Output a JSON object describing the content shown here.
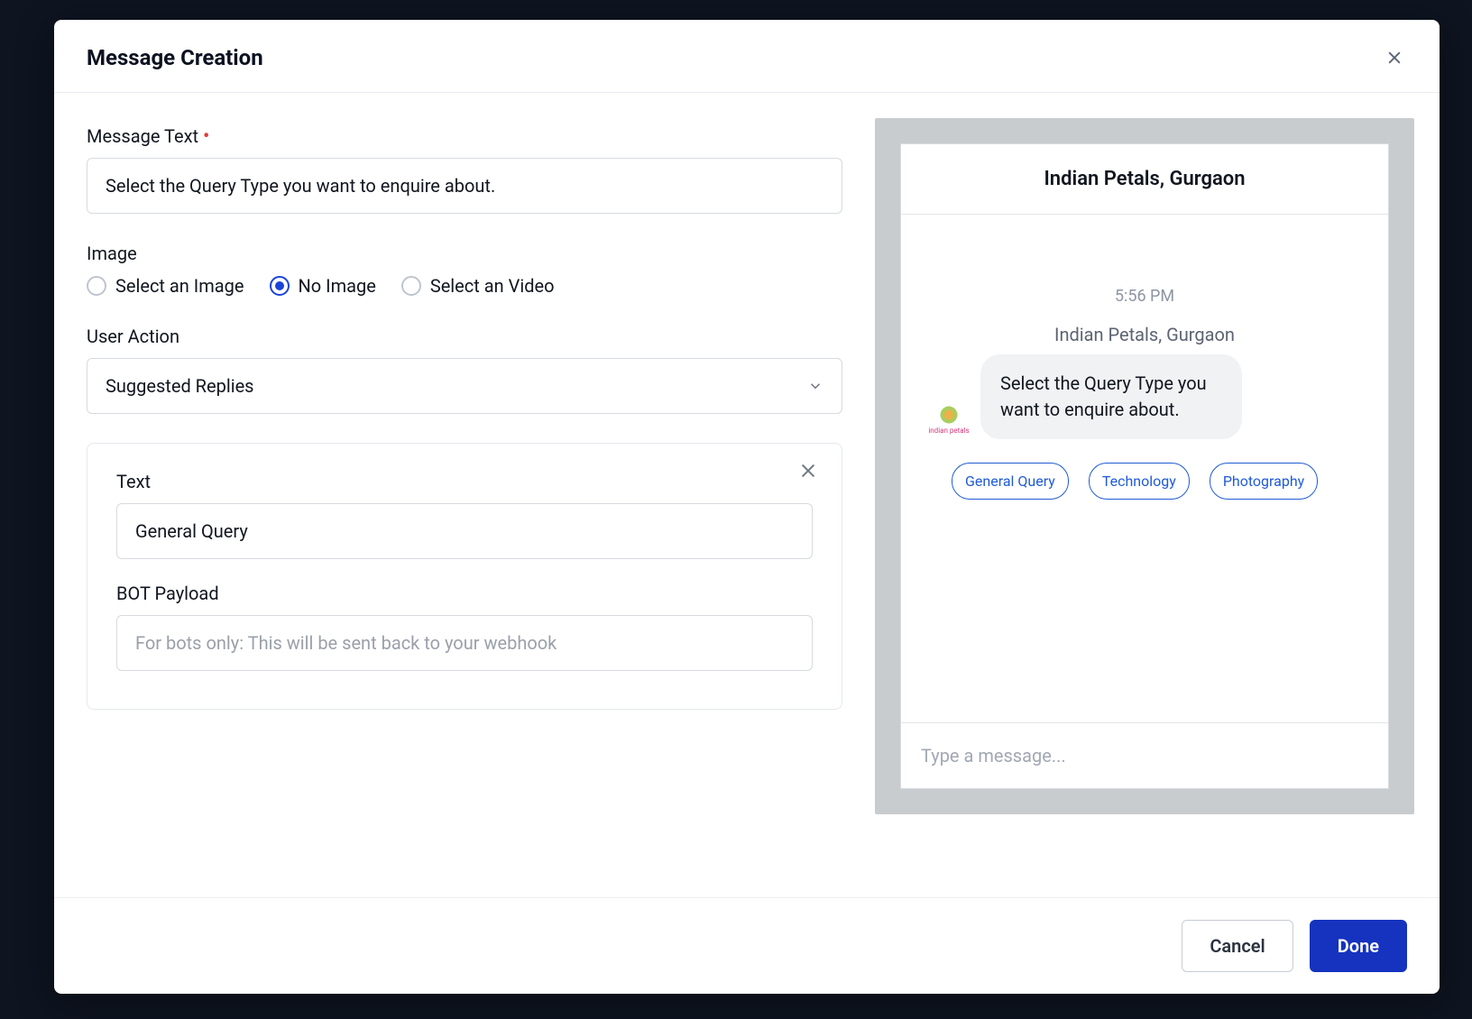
{
  "modal": {
    "title": "Message Creation",
    "footer": {
      "cancel": "Cancel",
      "done": "Done"
    }
  },
  "form": {
    "message_text": {
      "label": "Message Text",
      "value": "Select the Query Type you want to enquire about."
    },
    "image": {
      "label": "Image",
      "options": [
        "Select an Image",
        "No Image",
        "Select an Video"
      ],
      "selected_index": 1
    },
    "user_action": {
      "label": "User Action",
      "selected": "Suggested Replies"
    },
    "reply_card": {
      "text": {
        "label": "Text",
        "value": "General Query"
      },
      "payload": {
        "label": "BOT Payload",
        "placeholder": "For bots only: This will be sent back to your webhook"
      }
    }
  },
  "preview": {
    "header": "Indian Petals, Gurgaon",
    "time": "5:56 PM",
    "sender": "Indian Petals, Gurgaon",
    "avatar_label": "indian petals",
    "bubble": "Select the Query Type you want to enquire about.",
    "chips": [
      "General Query",
      "Technology",
      "Photography"
    ],
    "input_placeholder": "Type a message..."
  }
}
